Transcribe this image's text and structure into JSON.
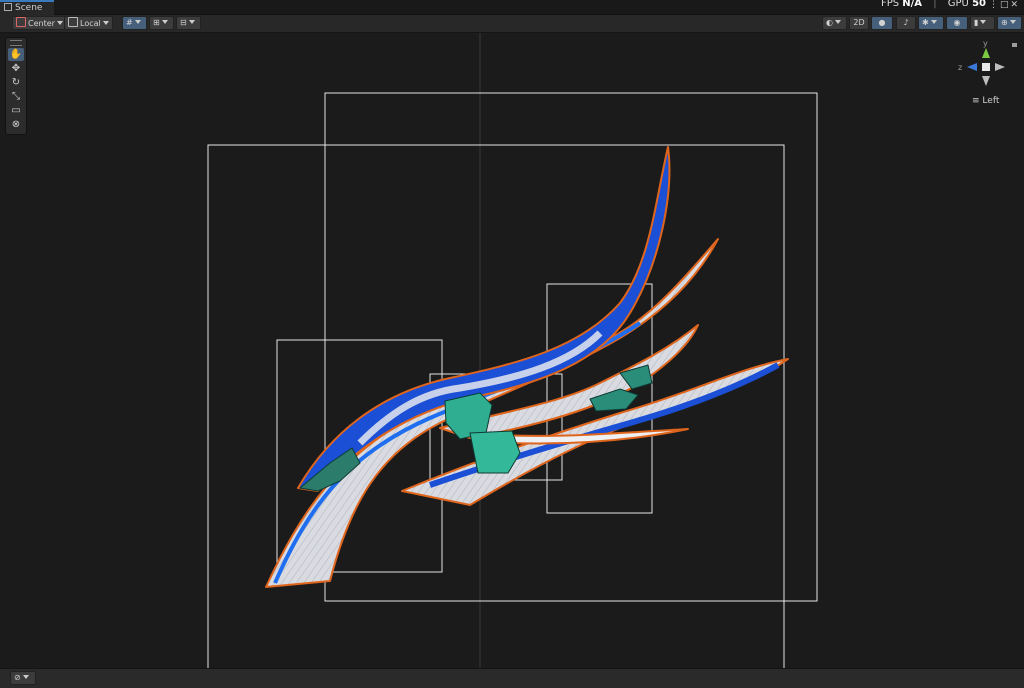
{
  "window": {
    "tab_title": "Scene"
  },
  "perf": {
    "fps_label": "FPS",
    "fps_value": "N/A",
    "gpu_label": "GPU",
    "gpu_value": "50"
  },
  "toolbar": {
    "pivot_label": "Center",
    "space_label": "Local",
    "twod_label": "2D"
  },
  "tools": [
    "hand-tool",
    "move-tool",
    "rotate-tool",
    "scale-tool",
    "rect-tool",
    "transform-tool"
  ],
  "gizmo": {
    "view_label": "Left",
    "axis_y": "y",
    "axis_z": "z"
  },
  "colors": {
    "accent": "#46607c",
    "ribbon_blue": "#1a4fd6",
    "selection_orange": "#e0651c",
    "bounds_white": "#e6e6e6",
    "prop_teal": "#2fae92"
  }
}
